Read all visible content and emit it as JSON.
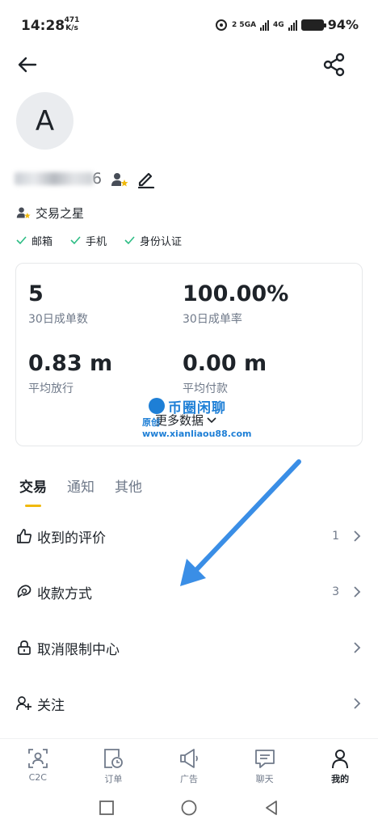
{
  "status_bar": {
    "time": "14:28",
    "speed_value": "471",
    "speed_unit": "K/s",
    "network": "2 5GA",
    "network2": "4G",
    "battery": "94%"
  },
  "profile": {
    "avatar_letter": "A",
    "username_tail": "6",
    "badge": "交易之星",
    "verifications": [
      "邮箱",
      "手机",
      "身份认证"
    ]
  },
  "stats": {
    "orders_30d": {
      "value": "5",
      "label": "30日成单数"
    },
    "completion_rate": {
      "value": "100.00%",
      "label": "30日成单率"
    },
    "avg_release": {
      "value": "0.83 m",
      "label": "平均放行"
    },
    "avg_pay": {
      "value": "0.00 m",
      "label": "平均付款"
    },
    "more_data": "更多数据"
  },
  "watermark": {
    "title": "币圈闲聊",
    "subtitle": "原创 www.xianliaou88.com"
  },
  "tabs": [
    "交易",
    "通知",
    "其他"
  ],
  "menu": [
    {
      "label": "收到的评价",
      "count": "1"
    },
    {
      "label": "收款方式",
      "count": "3"
    },
    {
      "label": "取消限制中心",
      "count": ""
    },
    {
      "label": "关注",
      "count": ""
    }
  ],
  "bottom_nav": [
    "C2C",
    "订单",
    "广告",
    "聊天",
    "我的"
  ],
  "colors": {
    "accent": "#f0b90b",
    "arrow": "#3a8ee6",
    "text_primary": "#1e2329",
    "text_secondary": "#707a8a",
    "check": "#2ebd85"
  }
}
